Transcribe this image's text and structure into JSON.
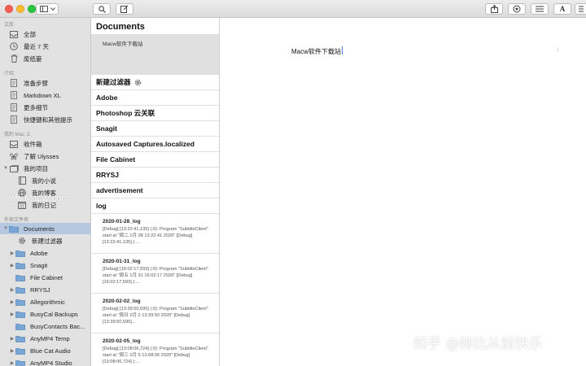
{
  "toolbar": {
    "icons": [
      "sidebar-toggle-icon",
      "chevron-down-icon",
      "search-icon",
      "compose-icon",
      "share-icon",
      "goals-icon",
      "list-icon",
      "font-icon",
      "attachments-icon"
    ],
    "font_label": "A"
  },
  "sidebar": {
    "sections": {
      "library": "文库",
      "intro": "介绍",
      "on_mac": "我的 Mac 上",
      "external": "外部文件夹"
    },
    "library_items": [
      {
        "label": "全部",
        "icon": "tray-icon"
      },
      {
        "label": "最近 7 天",
        "icon": "clock-icon"
      },
      {
        "label": "废纸篓",
        "icon": "trash-icon"
      }
    ],
    "intro_items": [
      {
        "label": "准备步骤",
        "icon": "sheet-icon"
      },
      {
        "label": "Markdown XL",
        "icon": "sheet-icon"
      },
      {
        "label": "更多细节",
        "icon": "sheet-icon"
      },
      {
        "label": "快捷键和其他提示",
        "icon": "sheet-icon"
      }
    ],
    "mac_items": [
      {
        "label": "收件箱",
        "icon": "inbox-icon"
      },
      {
        "label": "了解 Ulysses",
        "icon": "butterfly-icon"
      },
      {
        "label": "我的项目",
        "icon": "stack-icon"
      },
      {
        "label": "我的小说",
        "icon": "book-icon"
      },
      {
        "label": "我的博客",
        "icon": "globe-icon"
      },
      {
        "label": "我的日记",
        "icon": "calendar-icon"
      }
    ],
    "external_items": [
      {
        "label": "Documents",
        "icon": "folder-icon"
      },
      {
        "label": "新建过滤器",
        "icon": "gear-icon"
      },
      {
        "label": "Adobe",
        "icon": "folder-icon"
      },
      {
        "label": "Snagit",
        "icon": "folder-icon"
      },
      {
        "label": "File Cabinet",
        "icon": "folder-icon"
      },
      {
        "label": "RRYSJ",
        "icon": "folder-icon"
      },
      {
        "label": "Allegorithmic",
        "icon": "folder-icon"
      },
      {
        "label": "BusyCal Backups",
        "icon": "folder-icon"
      },
      {
        "label": "BusyContacts Bac...",
        "icon": "folder-icon"
      },
      {
        "label": "AnyMP4 Temp",
        "icon": "folder-icon"
      },
      {
        "label": "Blue Cat Audio",
        "icon": "folder-icon"
      },
      {
        "label": "AnyMP4 Studio",
        "icon": "folder-icon"
      }
    ],
    "watermark": "www.MacW.com"
  },
  "middle": {
    "title": "Documents",
    "sheet_preview": "Macw软件下载站",
    "groups": [
      "新建过滤器",
      "Adobe",
      "Photoshop 云关联",
      "Snagit",
      "Autosaved Captures.localized",
      "File Cabinet",
      "RRYSJ",
      "advertisement",
      "log"
    ],
    "logs": [
      {
        "title": "2020-01-28_log",
        "snippet": "[Debug] [13:22:41,135] (:0): Program \"SubtitleClient\" start at \"周二 1月 28 13:22:41 2020\" [Debug] [13:22:41,135] (:..."
      },
      {
        "title": "2020-01-31_log",
        "snippet": "[Debug] [16:02:17,593] (:0): Program \"SubtitleClient\" start at \"周五 1月 31 16:02:17 2020\" [Debug] [16:02:17,593] (:..."
      },
      {
        "title": "2020-02-02_log",
        "snippet": "[Debug] [13:39:50,595] (:0): Program \"SubtitleClient\" start at \"周日 2月 2 13:39:50 2020\" [Debug] [13:39:50,595]..."
      },
      {
        "title": "2020-02-05_log",
        "snippet": "[Debug] [13:08:06,724] (:0): Program \"SubtitleClient\" start at \"周三 2月 5 13:08:06 2020\" [Debug] [13:08:06,724] (:..."
      }
    ]
  },
  "editor": {
    "text": "Macw软件下载站",
    "marker": "1"
  },
  "watermark": "知乎 @妳比从前快乐",
  "colors": {
    "selection_blue": "#b6c7e0",
    "caret": "#4a7fd8",
    "folder": "#7aa6d6"
  }
}
